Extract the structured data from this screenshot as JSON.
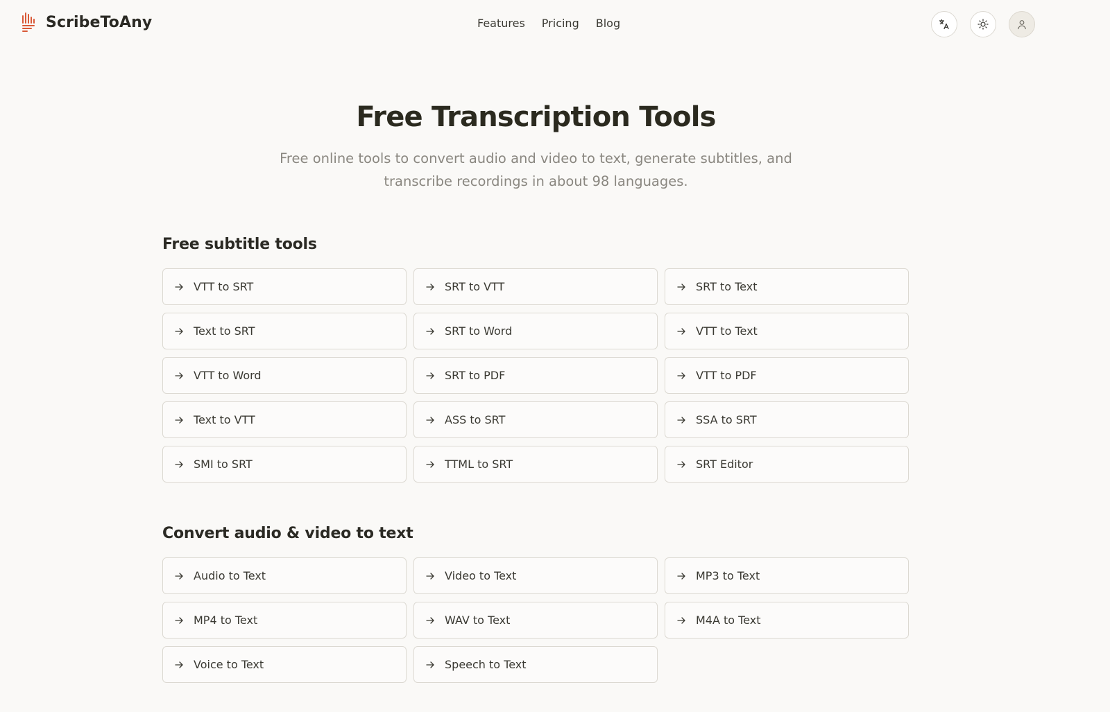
{
  "brand": {
    "name": "ScribeToAny",
    "accent": "#d95a38"
  },
  "nav": [
    {
      "label": "Features"
    },
    {
      "label": "Pricing"
    },
    {
      "label": "Blog"
    }
  ],
  "header_actions": {
    "language_icon": "translate-icon",
    "theme_icon": "sun-icon",
    "account_icon": "user-icon"
  },
  "hero": {
    "title": "Free Transcription Tools",
    "subtitle": "Free online tools to convert audio and video to text, generate subtitles, and transcribe recordings in about 98 languages."
  },
  "sections": [
    {
      "title": "Free subtitle tools",
      "tools": [
        "VTT to SRT",
        "SRT to VTT",
        "SRT to Text",
        "Text to SRT",
        "SRT to Word",
        "VTT to Text",
        "VTT to Word",
        "SRT to PDF",
        "VTT to PDF",
        "Text to VTT",
        "ASS to SRT",
        "SSA to SRT",
        "SMI to SRT",
        "TTML to SRT",
        "SRT Editor"
      ]
    },
    {
      "title": "Convert audio & video to text",
      "tools": [
        "Audio to Text",
        "Video to Text",
        "MP3 to Text",
        "MP4 to Text",
        "WAV to Text",
        "M4A to Text",
        "Voice to Text",
        "Speech to Text"
      ]
    }
  ]
}
